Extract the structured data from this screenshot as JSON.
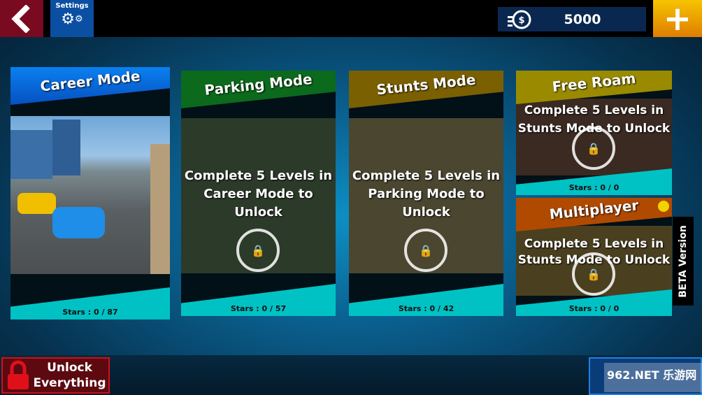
{
  "topbar": {
    "back_icon": "chevron-left-icon",
    "settings_label": "Settings",
    "settings_icon": "gears-icon",
    "coins": "5000",
    "coin_icon": "coin-stack-icon",
    "plus_icon": "plus-icon"
  },
  "modes": [
    {
      "title": "Career Mode",
      "stars": "Stars : 0 / 87",
      "color": "#0a6be0",
      "locked": false
    },
    {
      "title": "Parking Mode",
      "stars": "Stars : 0 / 57",
      "color": "#0b6a1c",
      "locked": true,
      "message": "Complete 5 Levels in Career Mode to Unlock"
    },
    {
      "title": "Stunts Mode",
      "stars": "Stars : 0 / 42",
      "color": "#7a6000",
      "locked": true,
      "message": "Complete 5 Levels in Parking Mode to Unlock"
    },
    {
      "title": "Free Roam",
      "stars": "Stars : 0 / 0",
      "color": "#9a8a00",
      "locked": true,
      "message": "Complete 5 Levels in Stunts Mode to Unlock"
    },
    {
      "title": "Multiplayer",
      "stars": "Stars : 0 / 0",
      "color": "#b04a00",
      "locked": true,
      "message": "Complete 5 Levels in Stunts Mode to Unlock"
    }
  ],
  "beta": "BETA Version",
  "bottom": {
    "unlock_label_1": "Unlock",
    "unlock_label_2": "Everything"
  },
  "watermark": "962.NET 乐游网"
}
